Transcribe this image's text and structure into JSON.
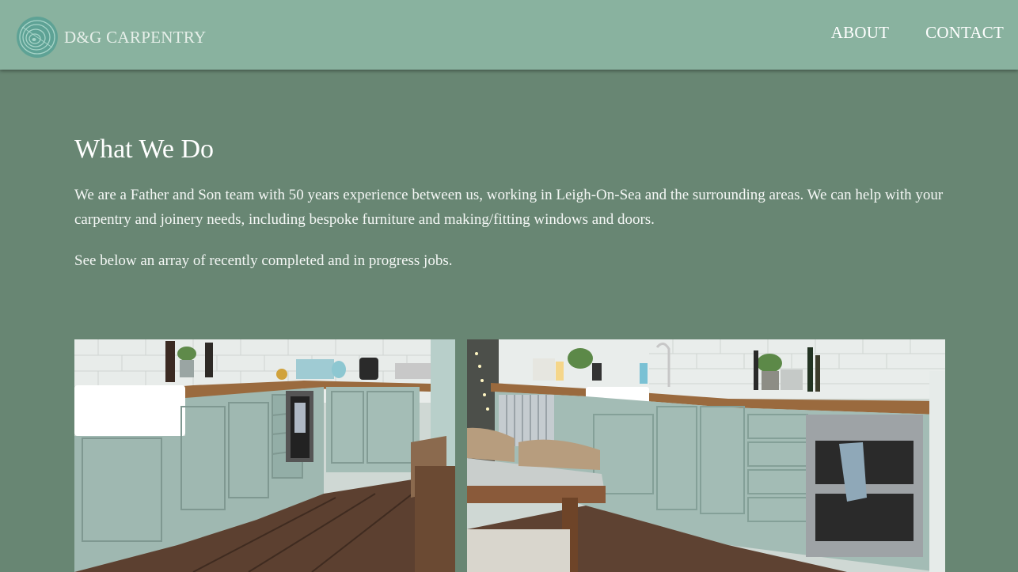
{
  "header": {
    "brand": "D&G CARPENTRY",
    "logo_icon": "wood-rings-logo-icon",
    "nav": [
      {
        "label": "ABOUT"
      },
      {
        "label": "CONTACT"
      }
    ]
  },
  "main": {
    "heading": "What We Do",
    "intro": "We are a Father and Son team with 50 years experience between us, working in Leigh-On-Sea and the surrounding areas. We can help with your carpentry and joinery needs, including bespoke furniture and making/fitting windows and doors.",
    "note": "See below an array of recently completed and in progress jobs."
  },
  "gallery": {
    "photo_1_subject": "kitchen-photo",
    "photo_2_subject": "kitchen-photo"
  },
  "colors": {
    "header_bg": "#89b29f",
    "page_bg": "#688673",
    "text": "#ffffff"
  }
}
